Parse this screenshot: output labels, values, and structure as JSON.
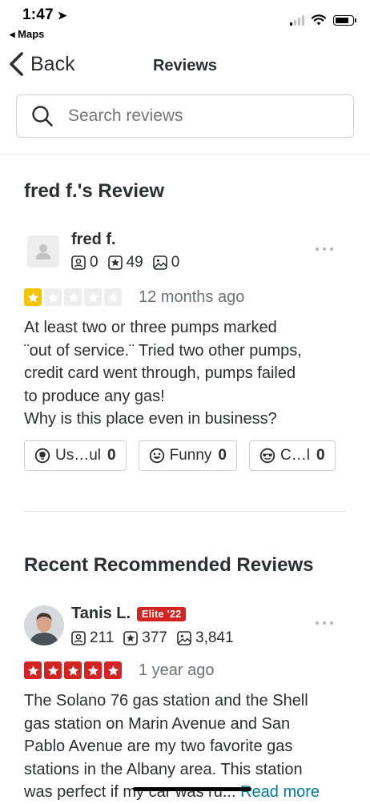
{
  "status_bar": {
    "time": "1:47",
    "back_app": "◂ Maps"
  },
  "nav": {
    "back_label": "Back",
    "title": "Reviews"
  },
  "search": {
    "placeholder": "Search reviews"
  },
  "review_section": {
    "heading": "fred f.'s Review",
    "user": {
      "name": "fred f.",
      "friends": "0",
      "reviews": "49",
      "photos": "0"
    },
    "rating": 1,
    "max_rating": 5,
    "time_ago": "12 months ago",
    "text_lines": [
      "At least two or three pumps marked",
      "¨out of service.¨ Tried two other pumps,",
      "credit card went through, pumps failed",
      "to produce any gas!",
      "Why is this place even in business?"
    ],
    "reactions": [
      {
        "label": "Us…ul",
        "count": "0",
        "icon": "lightbulb-icon"
      },
      {
        "label": "Funny",
        "count": "0",
        "icon": "smile-icon"
      },
      {
        "label": "C…l",
        "count": "0",
        "icon": "cool-sunglasses-icon"
      }
    ]
  },
  "recommended": {
    "heading": "Recent Recommended Reviews",
    "user": {
      "name": "Tanis L.",
      "badge": "Elite '22",
      "friends": "211",
      "reviews": "377",
      "photos": "3,841"
    },
    "rating": 5,
    "time_ago": "1 year ago",
    "text_lines": [
      "The Solano 76 gas station and the Shell",
      "gas station on Marin Avenue and San",
      "Pablo Avenue are my two favorite gas",
      "stations in the Albany area. This station"
    ],
    "last_line": "was perfect if my car was ru...",
    "read_more": "Read more"
  },
  "colors": {
    "yelp_red": "#d32323",
    "star_gold": "#f5c400",
    "star_empty": "#eeeeee",
    "link": "#027a97"
  }
}
